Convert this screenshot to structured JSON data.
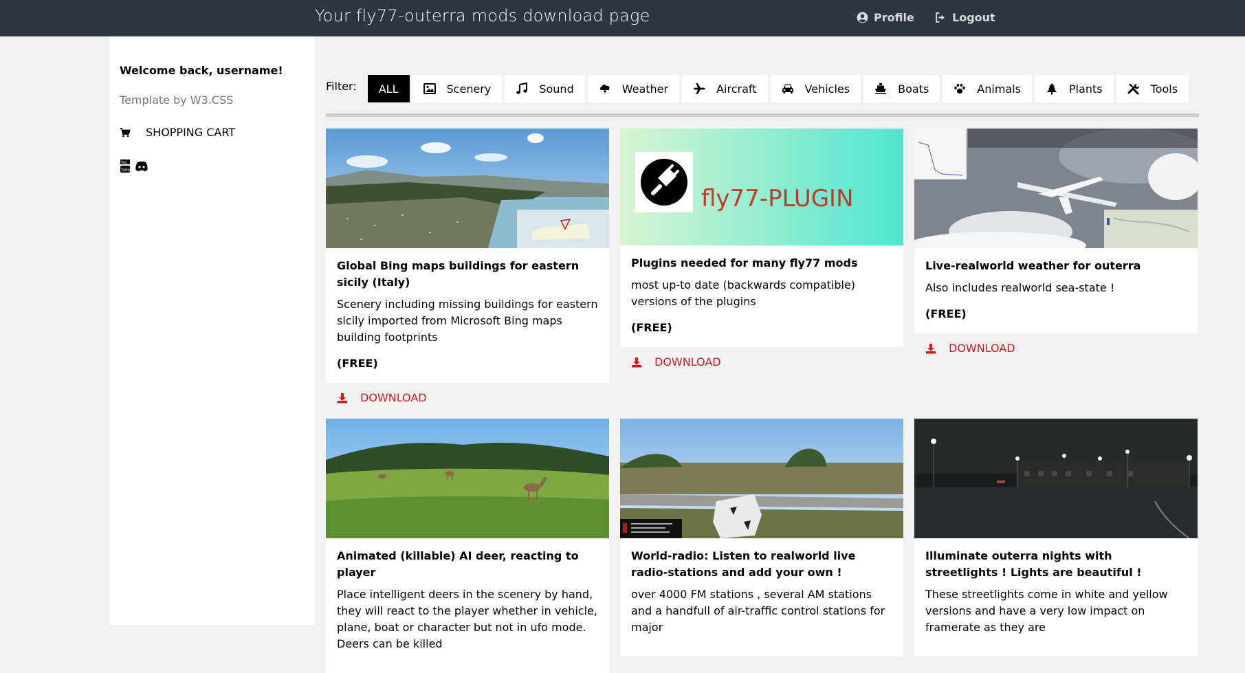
{
  "header": {
    "title": "Your fly77-outerra mods download page",
    "profile_label": "Profile",
    "logout_label": "Logout"
  },
  "sidebar": {
    "welcome": "Welcome back, username!",
    "template_credit": "Template by W3.CSS",
    "cart_label": "SHOPPING CART",
    "social_icons": [
      "youtube-icon",
      "discord-icon"
    ]
  },
  "filter": {
    "label": "Filter:",
    "buttons": [
      {
        "label": "ALL",
        "icon": "",
        "active": true
      },
      {
        "label": "Scenery",
        "icon": "image-icon"
      },
      {
        "label": "Sound",
        "icon": "music-icon"
      },
      {
        "label": "Weather",
        "icon": "cloud-bolt-icon"
      },
      {
        "label": "Aircraft",
        "icon": "plane-icon"
      },
      {
        "label": "Vehicles",
        "icon": "car-icon"
      },
      {
        "label": "Boats",
        "icon": "ship-icon"
      },
      {
        "label": "Animals",
        "icon": "paw-icon"
      },
      {
        "label": "Plants",
        "icon": "tree-icon"
      },
      {
        "label": "Tools",
        "icon": "tools-icon"
      }
    ]
  },
  "cards": [
    {
      "title": "Global Bing maps buildings for eastern sicily (Italy)",
      "description": "Scenery including missing buildings for eastern sicily imported from Microsoft Bing maps building footprints",
      "price": "(FREE)",
      "download_label": "DOWNLOAD"
    },
    {
      "title": "Plugins needed for many fly77 mods",
      "description": "most up-to date (backwards compatible) versions of the plugins",
      "price": "(FREE)",
      "download_label": "DOWNLOAD",
      "image_text": "fly77-PLUGIN"
    },
    {
      "title": "Live-realworld weather for outerra",
      "description": "Also includes realworld sea-state !",
      "price": "(FREE)",
      "download_label": "DOWNLOAD"
    },
    {
      "title": "Animated (killable) AI deer, reacting to player",
      "description": "Place intelligent deers in the scenery by hand, they will react to the player whether in vehicle, plane, boat or character but not in ufo mode. Deers can be killed"
    },
    {
      "title": "World-radio: Listen to realworld live radio-stations and add your own !",
      "description": "over 4000 FM stations , several AM stations and a handfull of air-traffic control stations for major"
    },
    {
      "title": "Illuminate outerra nights with streetlights ! Lights are beautiful !",
      "description": "These streetlights come in white and yellow versions and have a very low impact on framerate as they are"
    }
  ],
  "colors": {
    "topbar": "#2e3641",
    "download": "#d31a1a",
    "active_filter": "#000000",
    "page_bg": "#f1f1f1"
  }
}
